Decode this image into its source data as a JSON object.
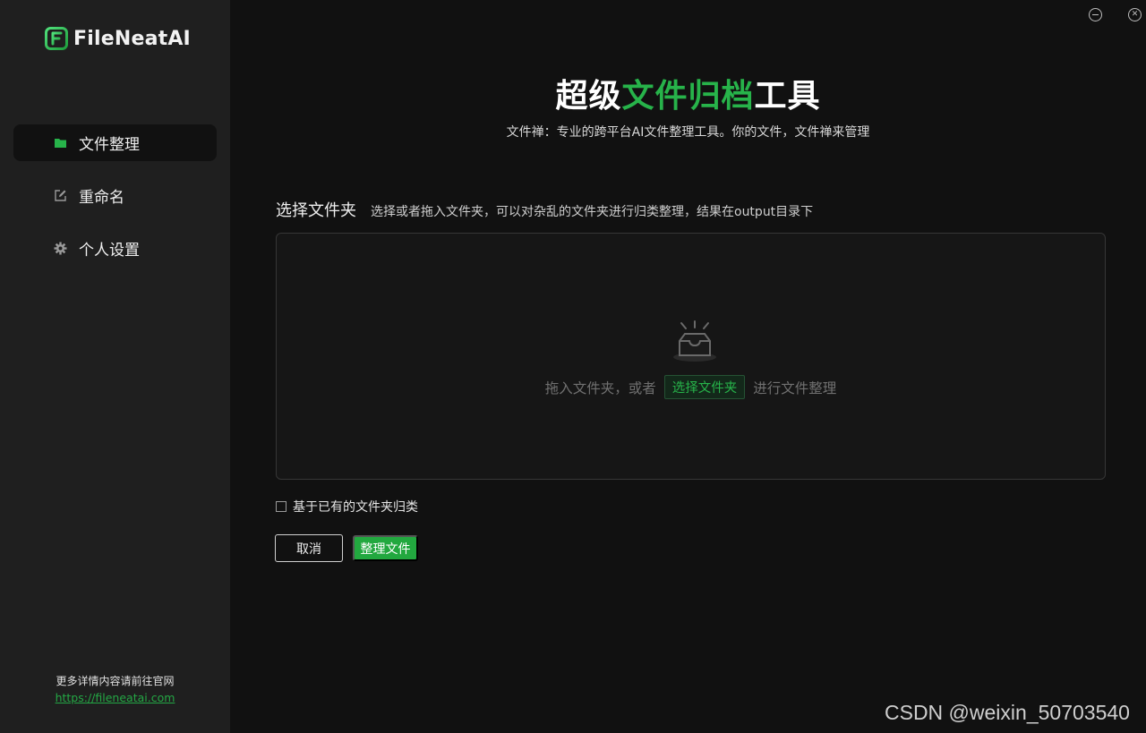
{
  "app": {
    "name": "FileNeatAI",
    "accent_color": "#27b34a"
  },
  "sidebar": {
    "items": [
      {
        "label": "文件整理",
        "icon": "folder-icon",
        "active": true
      },
      {
        "label": "重命名",
        "icon": "edit-icon",
        "active": false
      },
      {
        "label": "个人设置",
        "icon": "gear-icon",
        "active": false
      }
    ],
    "footer_text": "更多详情内容请前往官网",
    "footer_link": "https://fileneatai.com"
  },
  "window_controls": {
    "minimize_icon": "minimize-icon",
    "close_icon": "close-icon"
  },
  "main": {
    "title_part1": "超级",
    "title_accent": "文件归档",
    "title_part2": "工具",
    "subtitle": "文件禅：专业的跨平台AI文件整理工具。你的文件，文件禅来管理",
    "section_title": "选择文件夹",
    "section_desc": "选择或者拖入文件夹，可以对杂乱的文件夹进行归类整理，结果在output目录下",
    "dropzone": {
      "icon": "empty-inbox-icon",
      "text_before": "拖入文件夹，或者",
      "button_label": "选择文件夹",
      "text_after": "进行文件整理"
    },
    "checkbox_label": "基于已有的文件夹归类",
    "checkbox_checked": false,
    "cancel_label": "取消",
    "primary_label": "整理文件"
  },
  "watermark": "CSDN @weixin_50703540"
}
